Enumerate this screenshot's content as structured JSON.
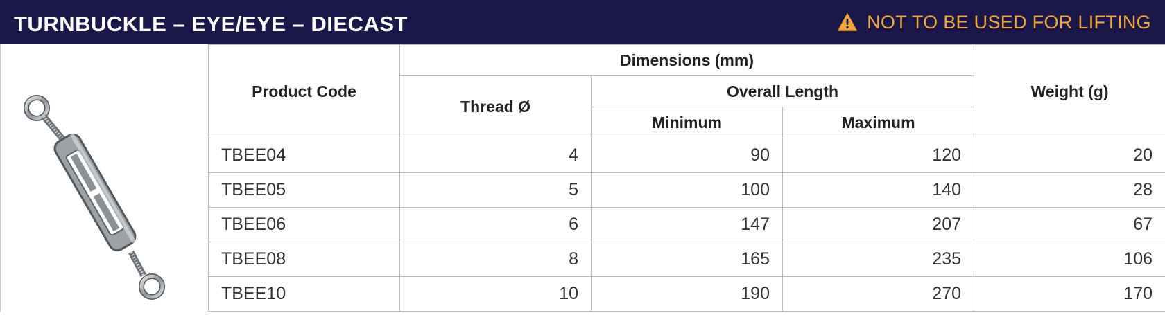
{
  "header": {
    "title": "TURNBUCKLE – EYE/EYE – DIECAST",
    "warning_icon": "warning-triangle-icon",
    "warning_text": "NOT TO BE USED FOR LIFTING",
    "colors": {
      "background": "#1b1748",
      "title": "#ffffff",
      "warning": "#f2a63a"
    }
  },
  "product_image": {
    "description_icon": "turnbuckle-image"
  },
  "table": {
    "headers": {
      "product_code": "Product Code",
      "dimensions": "Dimensions (mm)",
      "thread": "Thread Ø",
      "overall_length": "Overall Length",
      "minimum": "Minimum",
      "maximum": "Maximum",
      "weight": "Weight (g)"
    },
    "rows": [
      {
        "code": "TBEE04",
        "thread": "4",
        "min": "90",
        "max": "120",
        "weight": "20"
      },
      {
        "code": "TBEE05",
        "thread": "5",
        "min": "100",
        "max": "140",
        "weight": "28"
      },
      {
        "code": "TBEE06",
        "thread": "6",
        "min": "147",
        "max": "207",
        "weight": "67"
      },
      {
        "code": "TBEE08",
        "thread": "8",
        "min": "165",
        "max": "235",
        "weight": "106"
      },
      {
        "code": "TBEE10",
        "thread": "10",
        "min": "190",
        "max": "270",
        "weight": "170"
      }
    ]
  }
}
